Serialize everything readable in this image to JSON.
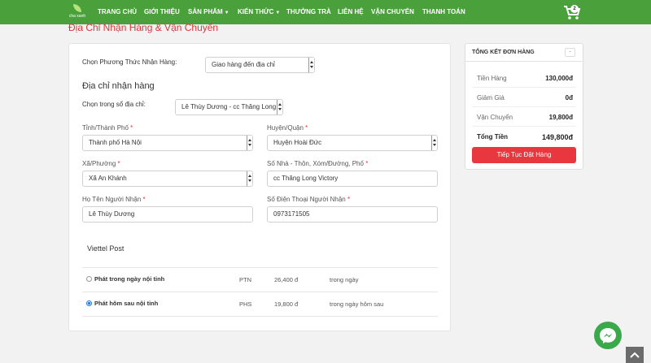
{
  "nav": {
    "logo_text": "cha xanh",
    "items": [
      {
        "label": "TRANG CHỦ",
        "caret": false
      },
      {
        "label": "GIỚI THIỆU",
        "caret": false
      },
      {
        "label": "SẢN PHẨM",
        "caret": true
      },
      {
        "label": "KIẾN THỨC",
        "caret": true
      },
      {
        "label": "THƯỞNG TRÀ",
        "caret": false
      },
      {
        "label": "LIÊN HỆ",
        "caret": false
      },
      {
        "label": "VẬN CHUYỂN",
        "caret": false
      },
      {
        "label": "THANH TOÁN",
        "caret": false
      }
    ],
    "cart_count": "2"
  },
  "page_title": "Địa Chỉ Nhận Hàng & Vận Chuyển",
  "form": {
    "method_label": "Chọn Phương Thức Nhận Hàng:",
    "method_value": "Giao hàng đến địa chỉ",
    "address_heading": "Địa chỉ nhận hàng",
    "address_book_label": "Chọn trong sổ địa chỉ:",
    "address_book_value": "Lê Thùy Dương - cc Thăng Long Vic",
    "province_label": "Tỉnh/Thành Phố",
    "province_value": "Thành phố Hà Nội",
    "district_label": "Huyện/Quận",
    "district_value": "Huyện Hoài Đức",
    "ward_label": "Xã/Phường",
    "ward_value": "Xã An Khánh",
    "street_label": "Số Nhà - Thôn, Xóm/Đường, Phố",
    "street_value": "cc Thăng Long Victory",
    "name_label": "Họ Tên Người Nhận",
    "name_value": "Lê Thùy Dương",
    "phone_label": "Số Điện Thoại Người Nhận",
    "phone_value": "0973171505",
    "required_mark": "*"
  },
  "shipping": {
    "carrier": "Viettel Post",
    "options": [
      {
        "name": "Phát trong ngày nội tỉnh",
        "code": "PTN",
        "price": "26,400 đ",
        "time": "trong ngày",
        "selected": false
      },
      {
        "name": "Phát hôm sau nội tỉnh",
        "code": "PHS",
        "price": "19,800 đ",
        "time": "trong ngày hôm sau",
        "selected": true
      }
    ]
  },
  "summary": {
    "title": "TỔNG KẾT ĐƠN HÀNG",
    "toggle": "-",
    "rows": [
      {
        "label": "Tiền Hàng",
        "value": "130,000đ"
      },
      {
        "label": "Giảm Giá",
        "value": "0đ"
      },
      {
        "label": "Vận Chuyển",
        "value": "19,800đ"
      }
    ],
    "total_label": "Tổng Tiền",
    "total_value": "149,800đ",
    "checkout_label": "Tiếp Tục Đặt Hàng"
  },
  "colors": {
    "nav_green": "#4aa13b",
    "accent_red": "#e8373e",
    "title_red": "#e0343a",
    "radio_blue": "#2b7bd9"
  }
}
